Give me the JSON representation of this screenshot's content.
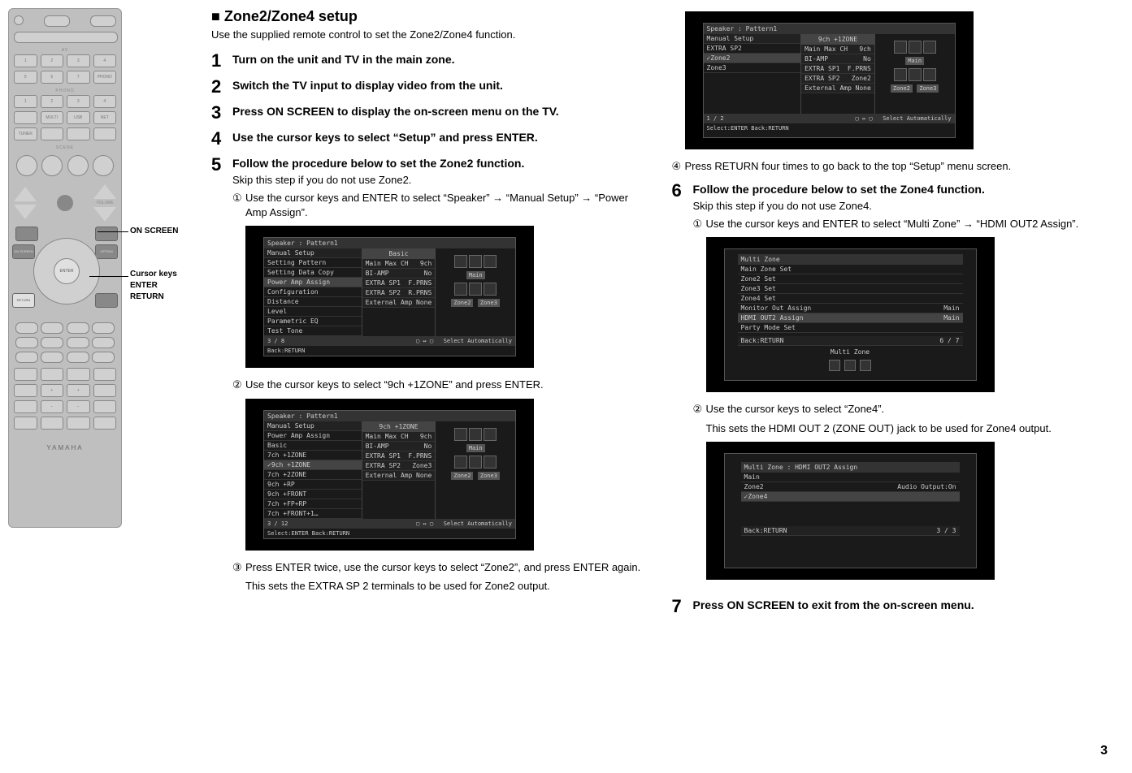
{
  "title": "Zone2/Zone4 setup",
  "intro": "Use the supplied remote control to set the Zone2/Zone4 function.",
  "remote": {
    "callout_onscreen": "ON SCREEN",
    "callout_cursor": "Cursor keys",
    "callout_enter": "ENTER",
    "callout_return": "RETURN",
    "label_av": "AV",
    "label_playback": "PHONO",
    "label_scene": "SCENE",
    "label_volume": "VOLUME",
    "btn_enter": "ENTER",
    "btn_onscreen": "ON SCREEN",
    "btn_return": "RETURN",
    "btn_option": "OPTION",
    "logo": "YAMAHA"
  },
  "steps": {
    "s1": "Turn on the unit and TV in the main zone.",
    "s2": "Switch the TV input to display video from the unit.",
    "s3": "Press ON SCREEN to display the on-screen menu on the TV.",
    "s4": "Use the cursor keys to select “Setup” and press ENTER.",
    "s5_head": "Follow the procedure below to set the Zone2 function.",
    "s5_sub": "Skip this step if you do not use Zone2.",
    "s5_1": "Use the cursor keys and ENTER to select “Speaker” → “Manual Setup” → “Power Amp Assign”.",
    "s5_2": "Use the cursor keys to select “9ch +1ZONE” and press ENTER.",
    "s5_3": "Press ENTER twice, use the cursor keys to select “Zone2”, and press ENTER again.",
    "s5_3_note": "This sets the EXTRA SP 2 terminals to be used for Zone2 output.",
    "s5_4": "Press RETURN four times to go back to the top “Setup” menu screen.",
    "s6_head": "Follow the procedure below to set the Zone4 function.",
    "s6_sub": "Skip this step if you do not use Zone4.",
    "s6_1": "Use the cursor keys and ENTER to select “Multi Zone” → “HDMI OUT2 Assign”.",
    "s6_2": "Use the cursor keys to select “Zone4”.",
    "s6_2_note": "This sets the HDMI OUT 2 (ZONE OUT) jack to be used for Zone4 output.",
    "s7": "Press ON SCREEN to exit from the on-screen menu."
  },
  "circ": {
    "c1": "①",
    "c2": "②",
    "c3": "③",
    "c4": "④"
  },
  "osd1": {
    "header": "Speaker : Pattern1",
    "title": "Basic",
    "left_top": "Manual Setup",
    "left": [
      "Setting Pattern",
      "Setting Data Copy",
      "Power Amp Assign",
      "Configuration",
      "Distance",
      "Level",
      "Parametric EQ",
      "Test Tone"
    ],
    "mid_labels": [
      "Main Max CH",
      "BI-AMP",
      "EXTRA SP1",
      "EXTRA SP2",
      "External Amp"
    ],
    "mid_vals": [
      "9ch",
      "No",
      "F.PRNS",
      "R.PRNS",
      "None"
    ],
    "right_labels": [
      "Main",
      "Zone2",
      "Zone3"
    ],
    "footer_l": "3 / 8",
    "footer_r": "Select Automatically",
    "bottom": "Back:RETURN"
  },
  "osd2": {
    "header": "Speaker : Pattern1",
    "title": "9ch +1ZONE",
    "left_top": "Manual Setup",
    "left_sub": "Power Amp Assign",
    "left": [
      "Basic",
      "7ch +1ZONE",
      "9ch +1ZONE",
      "7ch +2ZONE",
      "9ch +RP",
      "9ch +FRONT",
      "7ch +FP+RP",
      "7ch +FRONT+1…"
    ],
    "mid_labels": [
      "Main Max CH",
      "BI-AMP",
      "EXTRA SP1",
      "EXTRA SP2",
      "External Amp"
    ],
    "mid_vals": [
      "9ch",
      "No",
      "F.PRNS",
      "Zone3",
      "None"
    ],
    "right_labels": [
      "Main",
      "Zone2",
      "Zone3"
    ],
    "footer_l": "3 / 12",
    "footer_r": "Select Automatically",
    "bottom": "Select:ENTER   Back:RETURN"
  },
  "osd3": {
    "header": "Speaker : Pattern1",
    "title": "9ch +1ZONE",
    "left_top": "Manual Setup",
    "left_sub": "EXTRA SP2",
    "left": [
      "Zone2",
      "Zone3"
    ],
    "mid_labels": [
      "Main Max CH",
      "BI-AMP",
      "EXTRA SP1",
      "EXTRA SP2",
      "External Amp"
    ],
    "mid_vals": [
      "9ch",
      "No",
      "F.PRNS",
      "Zone2",
      "None"
    ],
    "right_labels": [
      "Main",
      "Zone2",
      "Zone3"
    ],
    "footer_l": "1 / 2",
    "footer_r": "Select Automatically",
    "bottom": "Select:ENTER   Back:RETURN"
  },
  "osd4": {
    "header": "Multi Zone",
    "rows": [
      "Main Zone Set",
      "Zone2 Set",
      "Zone3 Set",
      "Zone4 Set",
      "Monitor Out Assign",
      "HDMI OUT2 Assign",
      "Party Mode Set"
    ],
    "vals": [
      "",
      "",
      "",
      "",
      "Main",
      "Main",
      ""
    ],
    "back": "Back:RETURN",
    "page": "6 / 7",
    "caption": "Multi Zone"
  },
  "osd5": {
    "header": "Multi Zone : HDMI OUT2 Assign",
    "rows": [
      "Main",
      "Zone2",
      "Zone4"
    ],
    "val": "Audio Output:On",
    "back": "Back:RETURN",
    "page": "3 / 3"
  },
  "page_number": "3"
}
